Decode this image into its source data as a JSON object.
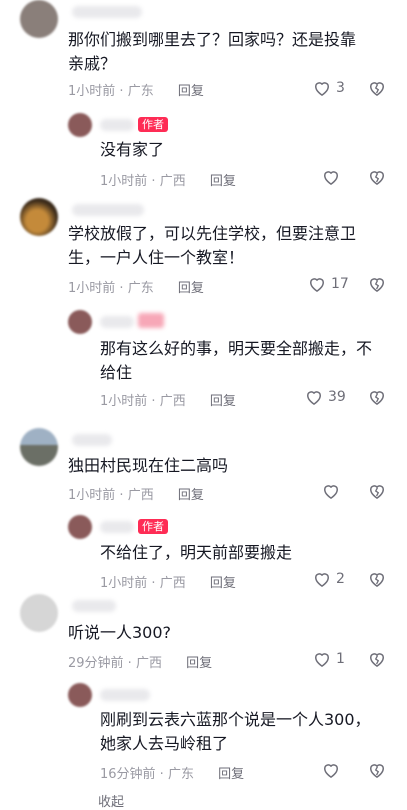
{
  "comments": [
    {
      "text_lines": [
        "那你们搬到哪里去了？回家吗？还是投靠",
        "亲戚？"
      ],
      "time": "1小时前",
      "location": "广东",
      "reply": "回复",
      "likes": "3",
      "avatar_color": "#8a7f7a",
      "reply_item": {
        "author_badge": "作者",
        "text_lines": [
          "没有家了"
        ],
        "time": "1小时前",
        "location": "广西",
        "reply": "回复",
        "likes": ""
      }
    },
    {
      "text_lines": [
        "学校放假了，可以先住学校，但要注意卫",
        "生，一户人住一个教室！"
      ],
      "time": "1小时前",
      "location": "广东",
      "reply": "回复",
      "likes": "17",
      "avatar_color": "#5b3c22",
      "reply_item": {
        "author_badge": "",
        "text_lines": [
          "那有这么好的事，明天要全部搬走，不",
          "给住"
        ],
        "time": "1小时前",
        "location": "广西",
        "reply": "回复",
        "likes": "39"
      }
    },
    {
      "text_lines": [
        "独田村民现在住二高吗"
      ],
      "time": "1小时前",
      "location": "广西",
      "reply": "回复",
      "likes": "",
      "avatar_color": "#7d8b9a",
      "reply_item": {
        "author_badge": "作者",
        "text_lines": [
          "不给住了，明天前部要搬走"
        ],
        "time": "1小时前",
        "location": "广西",
        "reply": "回复",
        "likes": "2"
      }
    },
    {
      "text_lines": [
        "听说一人300?"
      ],
      "time": "29分钟前",
      "location": "广西",
      "reply": "回复",
      "likes": "1",
      "avatar_color": "#d6d6d6",
      "reply_item": {
        "author_badge": "",
        "text_lines": [
          "刚刷到云表六蓝那个说是一个人300，",
          "她家人去马岭租了"
        ],
        "time": "16分钟前",
        "location": "广东",
        "reply": "回复",
        "likes": ""
      }
    }
  ],
  "colors": {
    "author_badge": "#fe2c55",
    "meta": "#9a9aa3",
    "text": "#161823"
  },
  "footer": {
    "expand_label": "收起"
  }
}
